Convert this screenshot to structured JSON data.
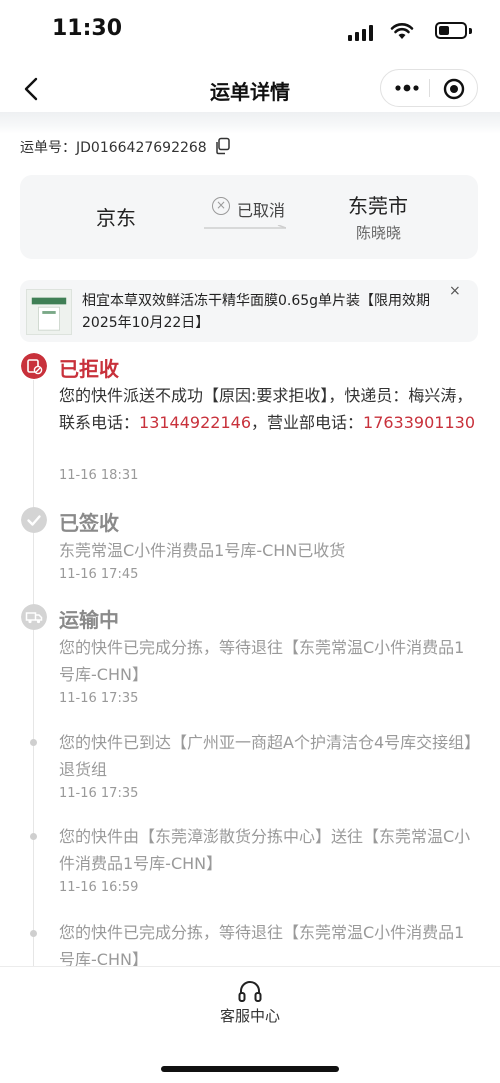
{
  "status_bar": {
    "time": "11:30"
  },
  "nav": {
    "title": "运单详情"
  },
  "waybill": {
    "label": "运单号：JD0166427692268"
  },
  "route": {
    "from": "京东",
    "status": "已取消",
    "to_city": "东莞市",
    "to_person": "陈晓晓"
  },
  "product": {
    "title": "相宜本草双效鲜活冻干精华面膜0.65g单片装【限用效期2025年10月22日】",
    "close": "×"
  },
  "timeline": {
    "e1": {
      "status": "已拒收",
      "text_a": "您的快件派送不成功【原因:要求拒收】，快递员：梅兴涛，联系电话：",
      "phone1": "13144922146",
      "text_b": "，营业部电话：",
      "phone2": "17633901130",
      "time": "11-16 18:31",
      "color": "#c8313b"
    },
    "e2": {
      "status": "已签收",
      "text": "东莞常温C小件消费品1号库-CHN已收货",
      "time": "11-16 17:45"
    },
    "e3": {
      "status": "运输中",
      "text": "您的快件已完成分拣，等待退往【东莞常温C小件消费品1号库-CHN】",
      "time": "11-16 17:35"
    },
    "e4": {
      "text": "您的快件已到达【广州亚一商超A个护清洁仓4号库交接组】退货组",
      "time": "11-16 17:35"
    },
    "e5": {
      "text": "您的快件由【东莞漳澎散货分拣中心】送往【东莞常温C小件消费品1号库-CHN】",
      "time": "11-16 16:59"
    },
    "e6": {
      "text": "您的快件已完成分拣，等待退往【东莞常温C小件消费品1号库-CHN】"
    }
  },
  "bottom": {
    "service_label": "客服中心"
  }
}
